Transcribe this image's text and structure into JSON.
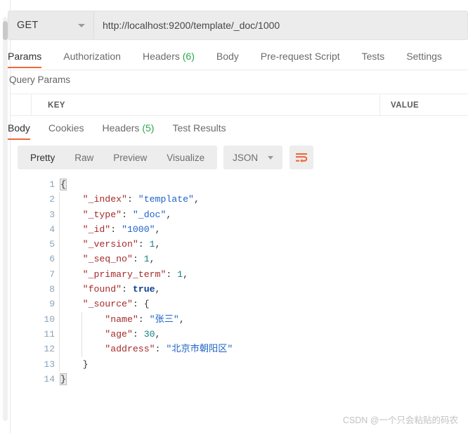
{
  "request": {
    "method": "GET",
    "url": "http://localhost:9200/template/_doc/1000",
    "tabs": [
      {
        "label": "Params",
        "count": "",
        "active": true
      },
      {
        "label": "Authorization",
        "count": "",
        "active": false
      },
      {
        "label": "Headers",
        "count": "(6)",
        "active": false
      },
      {
        "label": "Body",
        "count": "",
        "active": false
      },
      {
        "label": "Pre-request Script",
        "count": "",
        "active": false
      },
      {
        "label": "Tests",
        "count": "",
        "active": false
      },
      {
        "label": "Settings",
        "count": "",
        "active": false
      }
    ],
    "query_params": {
      "section_label": "Query Params",
      "col_key": "KEY",
      "col_value": "VALUE"
    }
  },
  "response": {
    "tabs": [
      {
        "label": "Body",
        "count": "",
        "active": true
      },
      {
        "label": "Cookies",
        "count": "",
        "active": false
      },
      {
        "label": "Headers",
        "count": "(5)",
        "active": false
      },
      {
        "label": "Test Results",
        "count": "",
        "active": false
      }
    ],
    "toolbar": {
      "formats": [
        {
          "label": "Pretty",
          "active": true
        },
        {
          "label": "Raw",
          "active": false
        },
        {
          "label": "Preview",
          "active": false
        },
        {
          "label": "Visualize",
          "active": false
        }
      ],
      "type_selected": "JSON",
      "wrap_icon": "word-wrap-icon"
    },
    "body_lines": [
      {
        "no": "1",
        "tokens": [
          {
            "t": "{",
            "c": "brace-hl p"
          }
        ]
      },
      {
        "no": "2",
        "indent": 1,
        "tokens": [
          {
            "t": "    \"_index\"",
            "c": "k"
          },
          {
            "t": ": ",
            "c": "p"
          },
          {
            "t": "\"template\"",
            "c": "s"
          },
          {
            "t": ",",
            "c": "p"
          }
        ]
      },
      {
        "no": "3",
        "indent": 1,
        "tokens": [
          {
            "t": "    \"_type\"",
            "c": "k"
          },
          {
            "t": ": ",
            "c": "p"
          },
          {
            "t": "\"_doc\"",
            "c": "s"
          },
          {
            "t": ",",
            "c": "p"
          }
        ]
      },
      {
        "no": "4",
        "indent": 1,
        "tokens": [
          {
            "t": "    \"_id\"",
            "c": "k"
          },
          {
            "t": ": ",
            "c": "p"
          },
          {
            "t": "\"1000\"",
            "c": "s"
          },
          {
            "t": ",",
            "c": "p"
          }
        ]
      },
      {
        "no": "5",
        "indent": 1,
        "tokens": [
          {
            "t": "    \"_version\"",
            "c": "k"
          },
          {
            "t": ": ",
            "c": "p"
          },
          {
            "t": "1",
            "c": "n"
          },
          {
            "t": ",",
            "c": "p"
          }
        ]
      },
      {
        "no": "6",
        "indent": 1,
        "tokens": [
          {
            "t": "    \"_seq_no\"",
            "c": "k"
          },
          {
            "t": ": ",
            "c": "p"
          },
          {
            "t": "1",
            "c": "n"
          },
          {
            "t": ",",
            "c": "p"
          }
        ]
      },
      {
        "no": "7",
        "indent": 1,
        "tokens": [
          {
            "t": "    \"_primary_term\"",
            "c": "k"
          },
          {
            "t": ": ",
            "c": "p"
          },
          {
            "t": "1",
            "c": "n"
          },
          {
            "t": ",",
            "c": "p"
          }
        ]
      },
      {
        "no": "8",
        "indent": 1,
        "tokens": [
          {
            "t": "    \"found\"",
            "c": "k"
          },
          {
            "t": ": ",
            "c": "p"
          },
          {
            "t": "true",
            "c": "b"
          },
          {
            "t": ",",
            "c": "p"
          }
        ]
      },
      {
        "no": "9",
        "indent": 1,
        "tokens": [
          {
            "t": "    \"_source\"",
            "c": "k"
          },
          {
            "t": ": ",
            "c": "p"
          },
          {
            "t": "{",
            "c": "p"
          }
        ]
      },
      {
        "no": "10",
        "indent": 2,
        "tokens": [
          {
            "t": "        \"name\"",
            "c": "k"
          },
          {
            "t": ": ",
            "c": "p"
          },
          {
            "t": "\"张三\"",
            "c": "s"
          },
          {
            "t": ",",
            "c": "p"
          }
        ]
      },
      {
        "no": "11",
        "indent": 2,
        "tokens": [
          {
            "t": "        \"age\"",
            "c": "k"
          },
          {
            "t": ": ",
            "c": "p"
          },
          {
            "t": "30",
            "c": "n"
          },
          {
            "t": ",",
            "c": "p"
          }
        ]
      },
      {
        "no": "12",
        "indent": 2,
        "tokens": [
          {
            "t": "        \"address\"",
            "c": "k"
          },
          {
            "t": ": ",
            "c": "p"
          },
          {
            "t": "\"北京市朝阳区\"",
            "c": "s"
          }
        ]
      },
      {
        "no": "13",
        "indent": 1,
        "tokens": [
          {
            "t": "    }",
            "c": "p"
          }
        ]
      },
      {
        "no": "14",
        "tokens": [
          {
            "t": "}",
            "c": "brace-hl p"
          }
        ]
      }
    ]
  },
  "watermark": "CSDN @一个只会粘贴的码农",
  "colors": {
    "accent": "#eb6a3d",
    "count_green": "#2aa84a",
    "json_key": "#a52a2a",
    "json_string": "#1f63c7",
    "json_number": "#108080",
    "json_boolean": "#0b3f96",
    "line_number": "#8aa3b8"
  }
}
